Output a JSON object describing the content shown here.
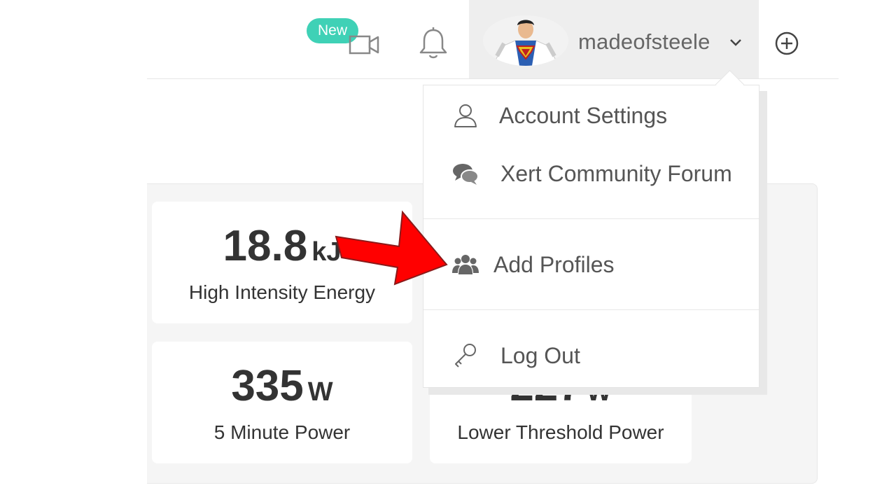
{
  "header": {
    "new_badge": "New",
    "username": "madeofsteele"
  },
  "metrics": [
    {
      "value": "18.8",
      "unit": "kJ",
      "label": "High Intensity Energy"
    },
    {
      "value": "335",
      "unit": "W",
      "label": "5 Minute Power"
    },
    {
      "value": "227",
      "unit": "W",
      "label": "Lower Threshold Power"
    }
  ],
  "dropdown": {
    "items": [
      {
        "label": "Account Settings",
        "icon": "user-icon"
      },
      {
        "label": "Xert Community Forum",
        "icon": "comments-icon"
      },
      {
        "label": "Add Profiles",
        "icon": "users-icon"
      },
      {
        "label": "Log Out",
        "icon": "key-icon"
      }
    ]
  },
  "colors": {
    "accent": "#3fd1b6",
    "arrow": "#ff0000",
    "user_menu_bg": "#eeeeee"
  }
}
